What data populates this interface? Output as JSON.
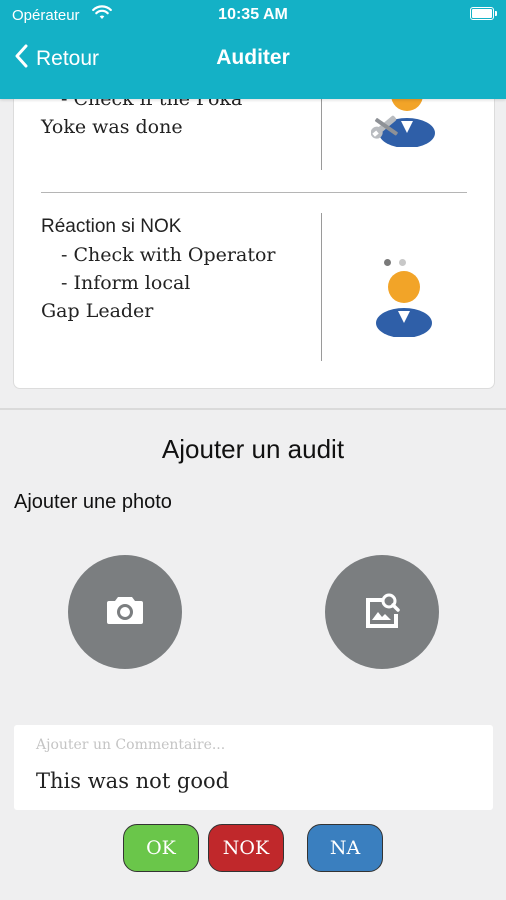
{
  "status_bar": {
    "carrier": "Opérateur",
    "time": "10:35 AM"
  },
  "nav": {
    "back_label": "Retour",
    "title": "Auditer"
  },
  "card": {
    "row1": {
      "lines": [
        "- Check if the Poka",
        "Yoke was done"
      ]
    },
    "row2": {
      "heading": "Réaction si NOK",
      "lines": [
        "- Check with Operator",
        "- Inform local",
        "Gap Leader"
      ]
    }
  },
  "section": {
    "title": "Ajouter un audit",
    "photo_label": "Ajouter une photo"
  },
  "photo_buttons": {
    "camera_icon": "camera-icon",
    "gallery_icon": "image-search-icon"
  },
  "comment": {
    "placeholder": "Ajouter un Commentaire...",
    "value": "This was not good"
  },
  "buttons": {
    "ok": {
      "label": "OK",
      "color": "#6ac64a"
    },
    "nok": {
      "label": "NOK",
      "color": "#c0282b"
    },
    "na": {
      "label": "NA",
      "color": "#3a7fbf"
    }
  },
  "colors": {
    "header": "#14b1c6",
    "circle_button": "#7b7e80"
  }
}
